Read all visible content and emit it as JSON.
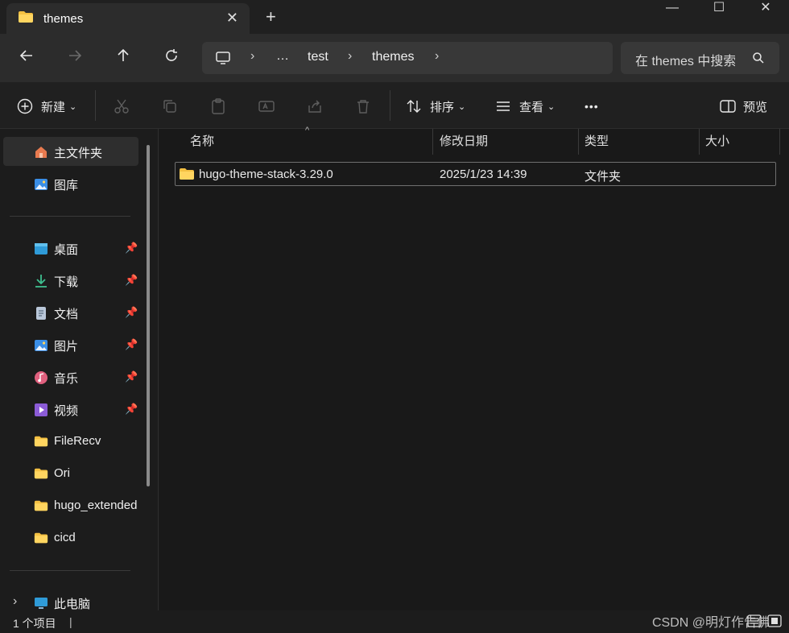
{
  "window": {
    "tab_title": "themes",
    "tab_close": "✕",
    "new_tab": "+",
    "minimize": "—",
    "maximize": "☐",
    "close": "✕"
  },
  "nav": {
    "breadcrumb": [
      "…",
      "test",
      "themes"
    ],
    "search_placeholder": "在 themes 中搜索"
  },
  "toolbar": {
    "new_label": "新建",
    "sort_label": "排序",
    "view_label": "查看",
    "more_label": "•••",
    "preview_label": "预览"
  },
  "sidebar": {
    "top_items": [
      {
        "label": "主文件夹",
        "icon": "home-icon"
      },
      {
        "label": "图库",
        "icon": "gallery-icon"
      }
    ],
    "quick_access": [
      {
        "label": "桌面",
        "icon": "desktop-icon",
        "pinned": true
      },
      {
        "label": "下载",
        "icon": "download-icon",
        "pinned": true
      },
      {
        "label": "文档",
        "icon": "document-icon",
        "pinned": true
      },
      {
        "label": "图片",
        "icon": "pictures-icon",
        "pinned": true
      },
      {
        "label": "音乐",
        "icon": "music-icon",
        "pinned": true
      },
      {
        "label": "视频",
        "icon": "video-icon",
        "pinned": true
      },
      {
        "label": "FileRecv",
        "icon": "folder-icon",
        "pinned": false
      },
      {
        "label": "Ori",
        "icon": "folder-icon",
        "pinned": false
      },
      {
        "label": "hugo_extended",
        "icon": "folder-icon",
        "pinned": false
      },
      {
        "label": "cicd",
        "icon": "folder-icon",
        "pinned": false
      }
    ],
    "this_pc": "此电脑"
  },
  "table": {
    "columns": [
      "名称",
      "修改日期",
      "类型",
      "大小"
    ],
    "rows": [
      {
        "name": "hugo-theme-stack-3.29.0",
        "modified": "2025/1/23 14:39",
        "type": "文件夹",
        "size": ""
      }
    ]
  },
  "status": {
    "item_count": "1 个项目",
    "watermark": "CSDN @明灯作告佛"
  },
  "colors": {
    "folder": "#f4c042",
    "background": "#191919",
    "accent": "#4fa3e0"
  }
}
